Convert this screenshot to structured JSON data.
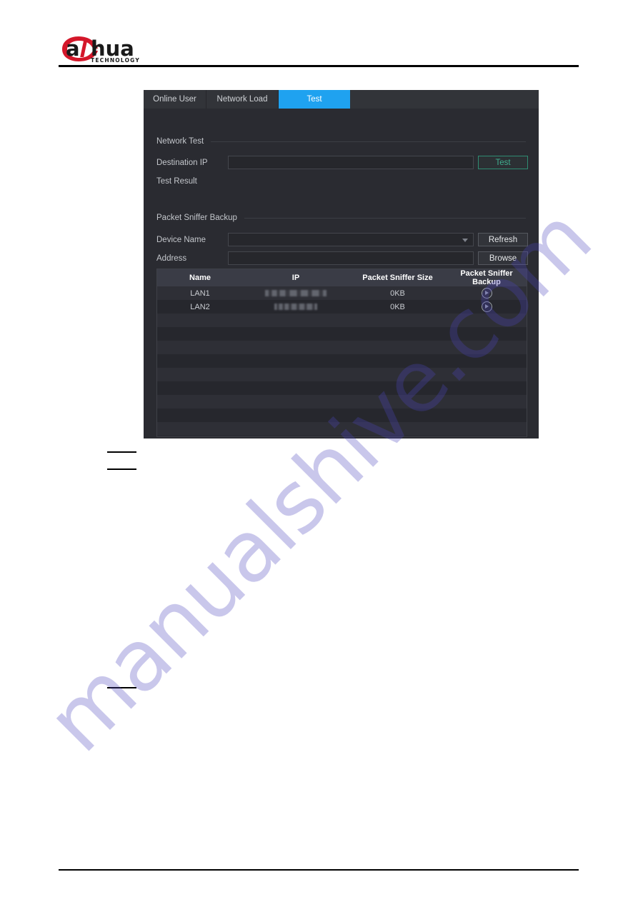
{
  "brand": {
    "name": "alhua",
    "tagline": "TECHNOLOGY"
  },
  "watermark": {
    "text": "manualshive.com",
    "color": "#4c46be"
  },
  "ui": {
    "tabs": [
      {
        "label": "Online User",
        "active": false
      },
      {
        "label": "Network Load",
        "active": false
      },
      {
        "label": "Test",
        "active": true
      }
    ],
    "sections": {
      "network_test": {
        "title": "Network Test",
        "destination_ip_label": "Destination IP",
        "destination_ip_value": "",
        "test_button": "Test",
        "test_result_label": "Test Result",
        "test_result_value": ""
      },
      "packet_sniffer": {
        "title": "Packet Sniffer Backup",
        "device_name_label": "Device Name",
        "device_name_value": "",
        "refresh_button": "Refresh",
        "address_label": "Address",
        "address_value": "",
        "browse_button": "Browse"
      }
    },
    "table": {
      "columns": [
        "Name",
        "IP",
        "Packet Sniffer Size",
        "Packet Sniffer Backup"
      ],
      "rows": [
        {
          "name": "LAN1",
          "ip": "",
          "size": "0KB",
          "backup_icon": "play-circle-icon"
        },
        {
          "name": "LAN2",
          "ip": "",
          "size": "0KB",
          "backup_icon": "play-circle-icon"
        }
      ],
      "empty_row_count": 10
    },
    "colors": {
      "panel_bg": "#2a2b31",
      "tab_active": "#1fa2f0",
      "accent_teal": "#3fae8f",
      "header_row": "#3a3c46"
    }
  }
}
